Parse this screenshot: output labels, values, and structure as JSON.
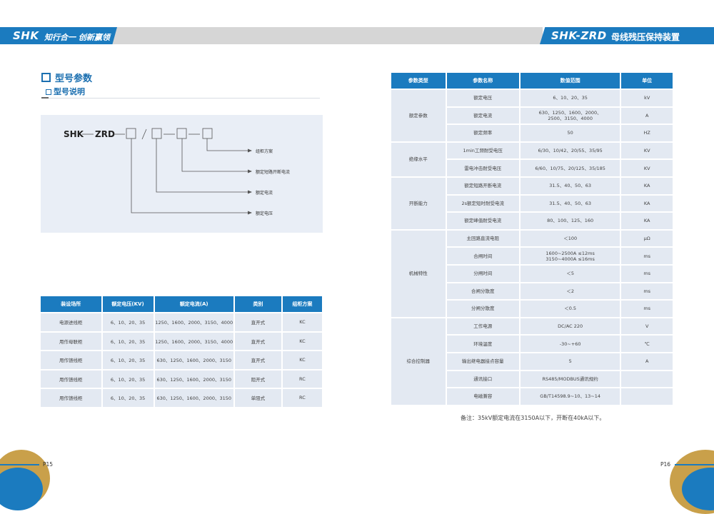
{
  "header": {
    "left_logo": "SHK",
    "left_slogan": "知行合一 创新赢领",
    "right_logo": "SHK-ZRD",
    "right_title": "母线残压保持装置"
  },
  "section": {
    "title": "型号参数",
    "subtitle": "型号说明"
  },
  "model_diagram": {
    "prefix": "SHK",
    "series": "ZRD",
    "labels": [
      "组柜方案",
      "额定短路开断电流",
      "额定电流",
      "额定电压"
    ]
  },
  "left_table": {
    "headers": [
      "装设场所",
      "额定电压(KV)",
      "额定电流(A)",
      "类别",
      "组柜方案"
    ],
    "rows": [
      [
        "电源进线柜",
        "6、10、20、35",
        "1250、1600、2000、3150、4000",
        "直开式",
        "KC"
      ],
      [
        "用作母联柜",
        "6、10、20、35",
        "1250、1600、2000、3150、4000",
        "直开式",
        "KC"
      ],
      [
        "用作馈线柜",
        "6、10、20、35",
        "630、1250、1600、2000、3150",
        "直开式",
        "KC"
      ],
      [
        "用作馈线柜",
        "6、10、20、35",
        "630、1250、1600、2000、3150",
        "阻开式",
        "RC"
      ],
      [
        "用作馈线柜",
        "6、10、20、35",
        "630、1250、1600、2000、3150",
        "单阻式",
        "RC"
      ]
    ]
  },
  "right_table": {
    "headers": [
      "参数类型",
      "参数名称",
      "数值范围",
      "单位"
    ],
    "groups": [
      {
        "category": "额定参数",
        "rows": [
          [
            "额定电压",
            "6、10、20、35",
            "kV"
          ],
          [
            "额定电流",
            "630、1250、1600、2000、\n2500、3150、4000",
            "A"
          ],
          [
            "额定频率",
            "50",
            "HZ"
          ]
        ]
      },
      {
        "category": "绝缘水平",
        "rows": [
          [
            "1min工频耐受电压",
            "6/30、10/42、20/55、35/95",
            "KV"
          ],
          [
            "雷电冲击耐受电压",
            "6/60、10/75、20/125、35/185",
            "KV"
          ]
        ]
      },
      {
        "category": "开断能力",
        "rows": [
          [
            "额定短路开断电流",
            "31.5、40、50、63",
            "KA"
          ],
          [
            "2s额定短时耐受电流",
            "31.5、40、50、63",
            "KA"
          ],
          [
            "额定峰值耐受电流",
            "80、100、125、160",
            "KA"
          ]
        ]
      },
      {
        "category": "机械特性",
        "rows": [
          [
            "主回路直流电阻",
            "＜100",
            "μΩ"
          ],
          [
            "合闸时间",
            "1600~2500A ≤12ms\n3150~4000A ≤16ms",
            "ms"
          ],
          [
            "分闸时间",
            "＜5",
            "ms"
          ],
          [
            "合闸分散度",
            "＜2",
            "ms"
          ],
          [
            "分闸分散度",
            "＜0.5",
            "ms"
          ]
        ]
      },
      {
        "category": "综合控制器",
        "rows": [
          [
            "工作电源",
            "DC/AC 220",
            "V"
          ],
          [
            "环境温度",
            "-30~+60",
            "℃"
          ],
          [
            "输出继电器接点容量",
            "5",
            "A"
          ],
          [
            "通讯接口",
            "RS485/MODBUS通讯规约",
            ""
          ],
          [
            "电磁兼容",
            "GB/T14598.9~10、13~14",
            ""
          ]
        ]
      }
    ]
  },
  "note": "备注：35kV额定电流在3150A以下，开断在40kA以下。",
  "footer": {
    "left_page": "P15",
    "right_page": "P16"
  },
  "colors": {
    "brand_blue": "#1b7bbf",
    "gold": "#c9a04a",
    "cell_bg": "#e3e9f2"
  }
}
